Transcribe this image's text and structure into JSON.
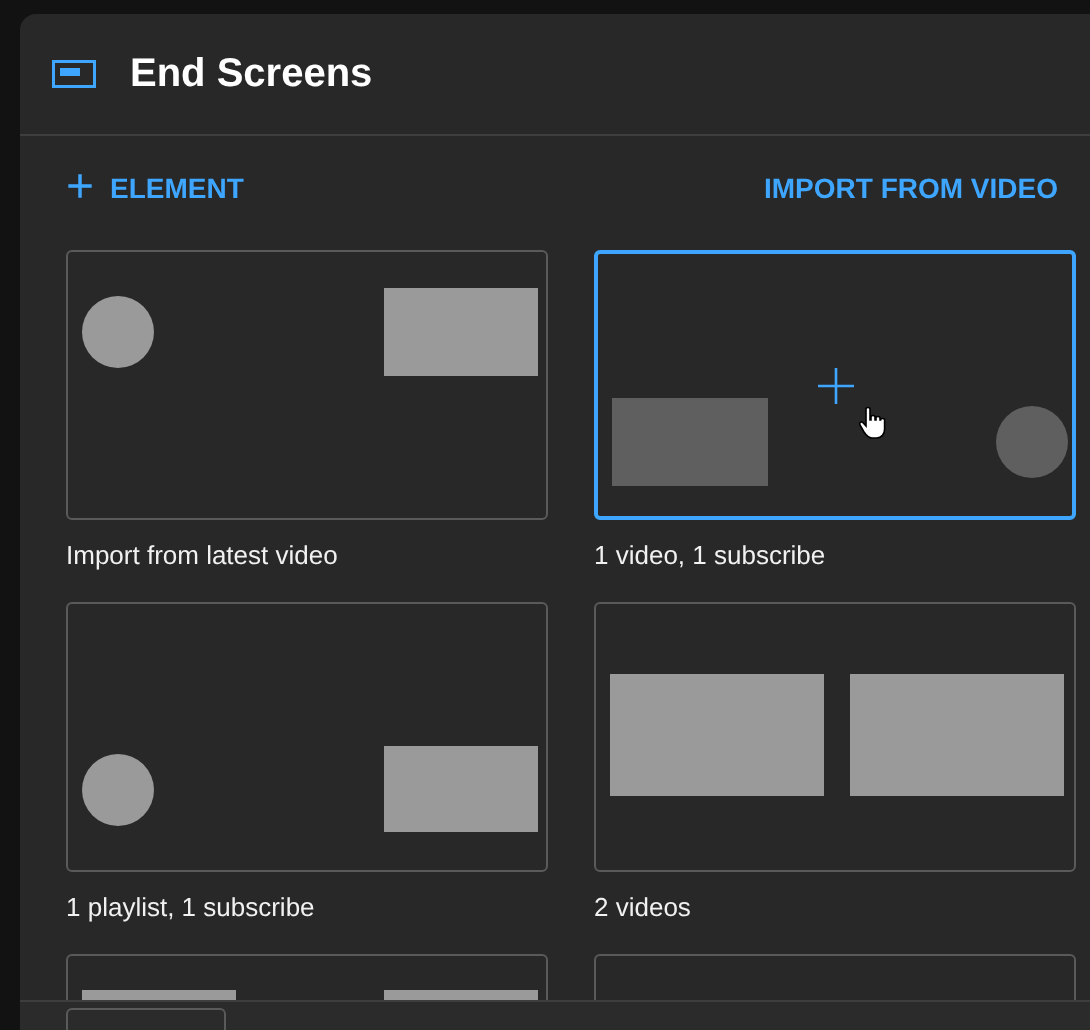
{
  "dialog": {
    "title": "End Screens"
  },
  "toolbar": {
    "add_button": {
      "icon": "+",
      "label": "ELEMENT"
    },
    "import_button": {
      "label": "IMPORT FROM VIDEO"
    }
  },
  "templates": [
    {
      "kind": "circle-rect",
      "label": "Import from latest video",
      "selected": false
    },
    {
      "kind": "rect-circle",
      "label": "1 video, 1 subscribe",
      "selected": true
    },
    {
      "kind": "circle-rect-low",
      "label": "1 playlist, 1 subscribe",
      "selected": false
    },
    {
      "kind": "two-videos",
      "label": "2 videos",
      "selected": false
    },
    {
      "kind": "top-bars",
      "selected": false
    },
    {
      "kind": "empty",
      "selected": false
    }
  ]
}
